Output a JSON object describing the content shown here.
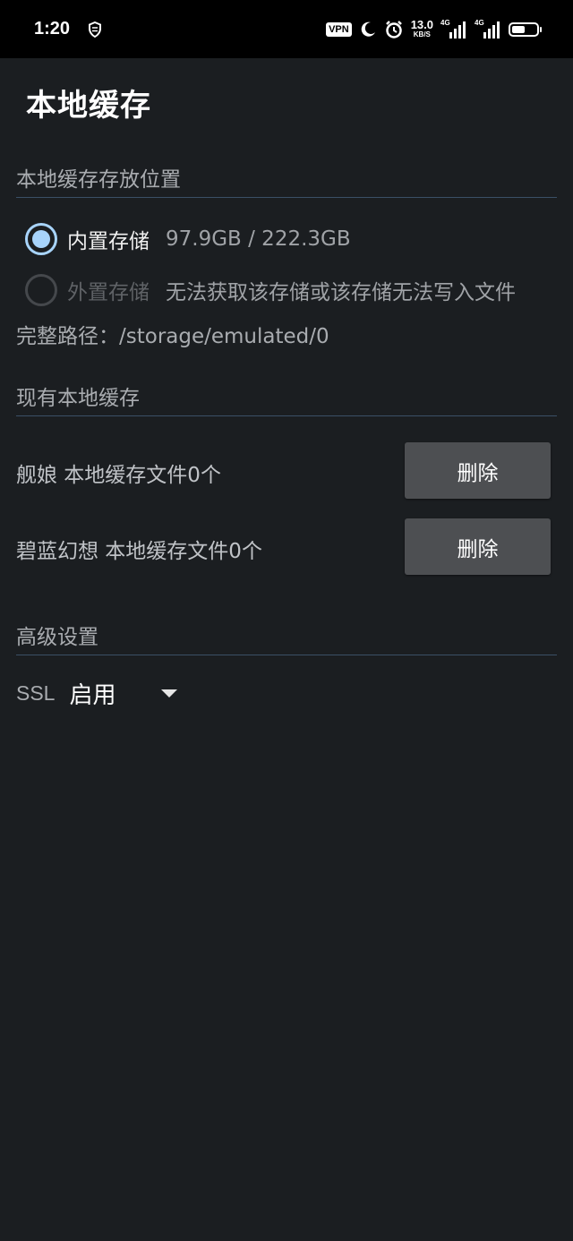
{
  "status_bar": {
    "time": "1:20",
    "vpn": "VPN",
    "net_speed_value": "13.0",
    "net_speed_unit": "KB/S",
    "signal1_label": "4G",
    "signal2_label": "4G",
    "battery_level": 0.55
  },
  "page": {
    "title": "本地缓存"
  },
  "storage_location": {
    "header": "本地缓存存放位置",
    "options": [
      {
        "label": "内置存储",
        "info": "97.9GB / 222.3GB",
        "selected": true,
        "enabled": true
      },
      {
        "label": "外置存储",
        "info": "无法获取该存储或该存储无法写入文件",
        "selected": false,
        "enabled": false
      }
    ],
    "path_label": "完整路径：",
    "path_value": "/storage/emulated/0"
  },
  "existing_cache": {
    "header": "现有本地缓存",
    "items": [
      {
        "label": "舰娘 本地缓存文件0个",
        "button": "删除"
      },
      {
        "label": "碧蓝幻想 本地缓存文件0个",
        "button": "删除"
      }
    ]
  },
  "advanced": {
    "header": "高级设置",
    "ssl_label": "SSL",
    "ssl_value": "启用"
  },
  "colors": {
    "background": "#1b1e21",
    "accent": "#a8d4fb",
    "divider": "#3b5066",
    "button": "#4d4f52"
  }
}
